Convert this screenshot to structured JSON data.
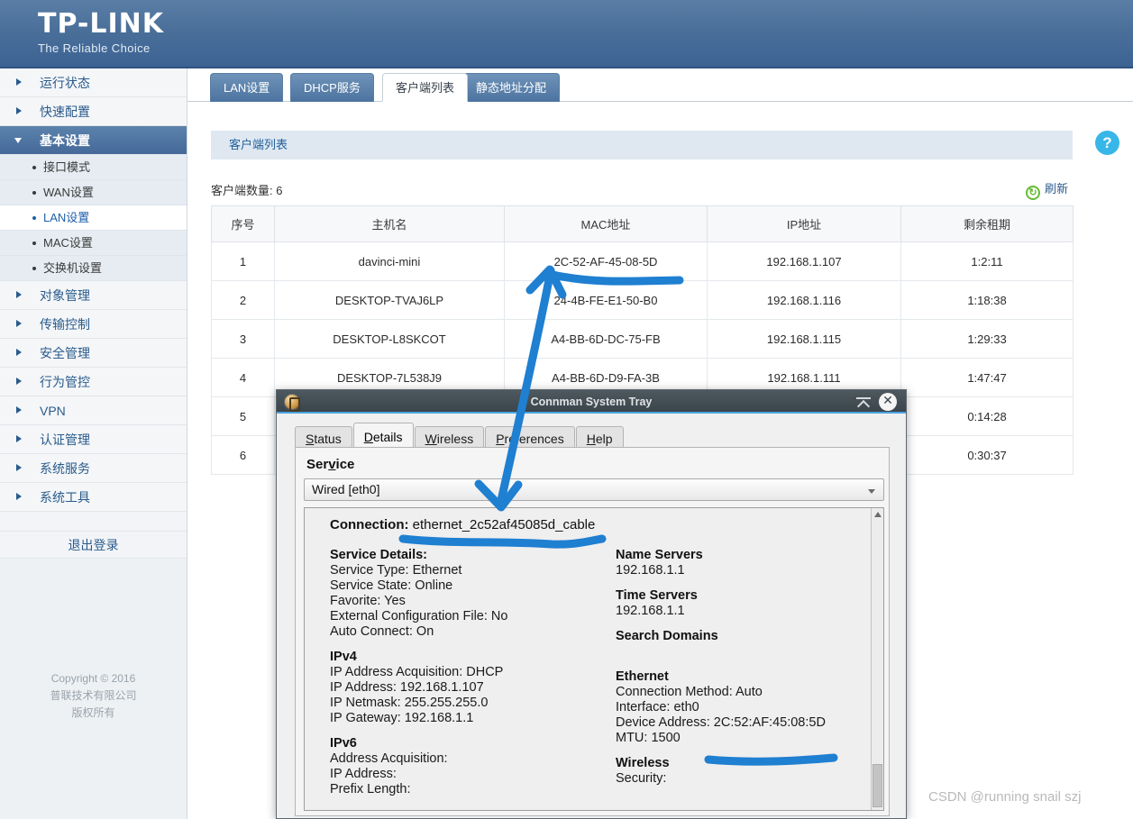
{
  "brand": {
    "name": "TP-LINK",
    "tagline": "The Reliable Choice"
  },
  "sidebar": {
    "items": [
      {
        "label": "运行状态",
        "type": "group"
      },
      {
        "label": "快速配置",
        "type": "group"
      },
      {
        "label": "基本设置",
        "type": "group-open"
      },
      {
        "label": "接口模式",
        "type": "sub"
      },
      {
        "label": "WAN设置",
        "type": "sub"
      },
      {
        "label": "LAN设置",
        "type": "sub-current"
      },
      {
        "label": "MAC设置",
        "type": "sub"
      },
      {
        "label": "交换机设置",
        "type": "sub"
      },
      {
        "label": "对象管理",
        "type": "group"
      },
      {
        "label": "传输控制",
        "type": "group"
      },
      {
        "label": "安全管理",
        "type": "group"
      },
      {
        "label": "行为管控",
        "type": "group"
      },
      {
        "label": "VPN",
        "type": "group"
      },
      {
        "label": "认证管理",
        "type": "group"
      },
      {
        "label": "系统服务",
        "type": "group"
      },
      {
        "label": "系统工具",
        "type": "group"
      }
    ],
    "logout": "退出登录",
    "copyright_line1": "Copyright © 2016",
    "copyright_line2": "普联技术有限公司",
    "copyright_line3": "版权所有"
  },
  "tabs": [
    {
      "label": "LAN设置",
      "selected": false
    },
    {
      "label": "DHCP服务",
      "selected": false
    },
    {
      "label": "客户端列表",
      "selected": true
    },
    {
      "label": "静态地址分配",
      "selected": false
    }
  ],
  "panel": {
    "title": "客户端列表",
    "help_icon": "?",
    "count_label": "客户端数量: 6",
    "refresh_label": "刷新",
    "refresh_icon": "refresh-icon"
  },
  "table": {
    "columns": [
      "序号",
      "主机名",
      "MAC地址",
      "IP地址",
      "剩余租期"
    ],
    "rows": [
      [
        "1",
        "davinci-mini",
        "2C-52-AF-45-08-5D",
        "192.168.1.107",
        "1:2:11"
      ],
      [
        "2",
        "DESKTOP-TVAJ6LP",
        "24-4B-FE-E1-50-B0",
        "192.168.1.116",
        "1:18:38"
      ],
      [
        "3",
        "DESKTOP-L8SKCOT",
        "A4-BB-6D-DC-75-FB",
        "192.168.1.115",
        "1:29:33"
      ],
      [
        "4",
        "DESKTOP-7L538J9",
        "A4-BB-6D-D9-FA-3B",
        "192.168.1.111",
        "1:47:47"
      ],
      [
        "5",
        "",
        "",
        "",
        "0:14:28"
      ],
      [
        "6",
        "",
        "",
        "",
        "0:30:37"
      ]
    ]
  },
  "dialog": {
    "title": "Connman System Tray",
    "shade_icon": "shade-icon",
    "close_icon": "close-icon",
    "tabs": [
      {
        "label": "Status",
        "selected": false
      },
      {
        "label": "Details",
        "selected": true
      },
      {
        "label": "Wireless",
        "selected": false
      },
      {
        "label": "Preferences",
        "selected": false
      },
      {
        "label": "Help",
        "selected": false
      }
    ],
    "service_heading": "Service",
    "service_value": "Wired [eth0]",
    "connection_label": "Connection:",
    "connection_value": "ethernet_2c52af45085d_cable",
    "left_column": [
      {
        "kind": "head",
        "text": "Service Details:"
      },
      {
        "kind": "line",
        "text": "Service Type: Ethernet"
      },
      {
        "kind": "line",
        "text": "Service State: Online"
      },
      {
        "kind": "line",
        "text": "Favorite: Yes"
      },
      {
        "kind": "line",
        "text": "External Configuration File: No"
      },
      {
        "kind": "line",
        "text": "Auto Connect: On"
      },
      {
        "kind": "head",
        "text": "IPv4"
      },
      {
        "kind": "line",
        "text": "IP Address Acquisition: DHCP"
      },
      {
        "kind": "line",
        "text": "IP Address: 192.168.1.107"
      },
      {
        "kind": "line",
        "text": "IP Netmask: 255.255.255.0"
      },
      {
        "kind": "line",
        "text": "IP Gateway: 192.168.1.1"
      },
      {
        "kind": "head",
        "text": "IPv6"
      },
      {
        "kind": "line",
        "text": "Address Acquisition:"
      },
      {
        "kind": "line",
        "text": "IP Address:"
      },
      {
        "kind": "line",
        "text": "Prefix Length:"
      }
    ],
    "right_column": [
      {
        "kind": "head",
        "text": "Name Servers"
      },
      {
        "kind": "line",
        "text": "192.168.1.1"
      },
      {
        "kind": "head",
        "text": "Time Servers"
      },
      {
        "kind": "line",
        "text": "192.168.1.1"
      },
      {
        "kind": "head",
        "text": "Search Domains"
      },
      {
        "kind": "line",
        "text": ""
      },
      {
        "kind": "head",
        "text": "Ethernet"
      },
      {
        "kind": "line",
        "text": "Connection Method: Auto"
      },
      {
        "kind": "line",
        "text": "Interface: eth0"
      },
      {
        "kind": "line",
        "text": "Device Address: 2C:52:AF:45:08:5D"
      },
      {
        "kind": "line",
        "text": "MTU: 1500"
      },
      {
        "kind": "head",
        "text": "Wireless"
      },
      {
        "kind": "line",
        "text": "Security:"
      }
    ]
  },
  "annotations": {
    "arrow_color": "#1f7fd1",
    "watermark": "CSDN @running snail szj"
  }
}
